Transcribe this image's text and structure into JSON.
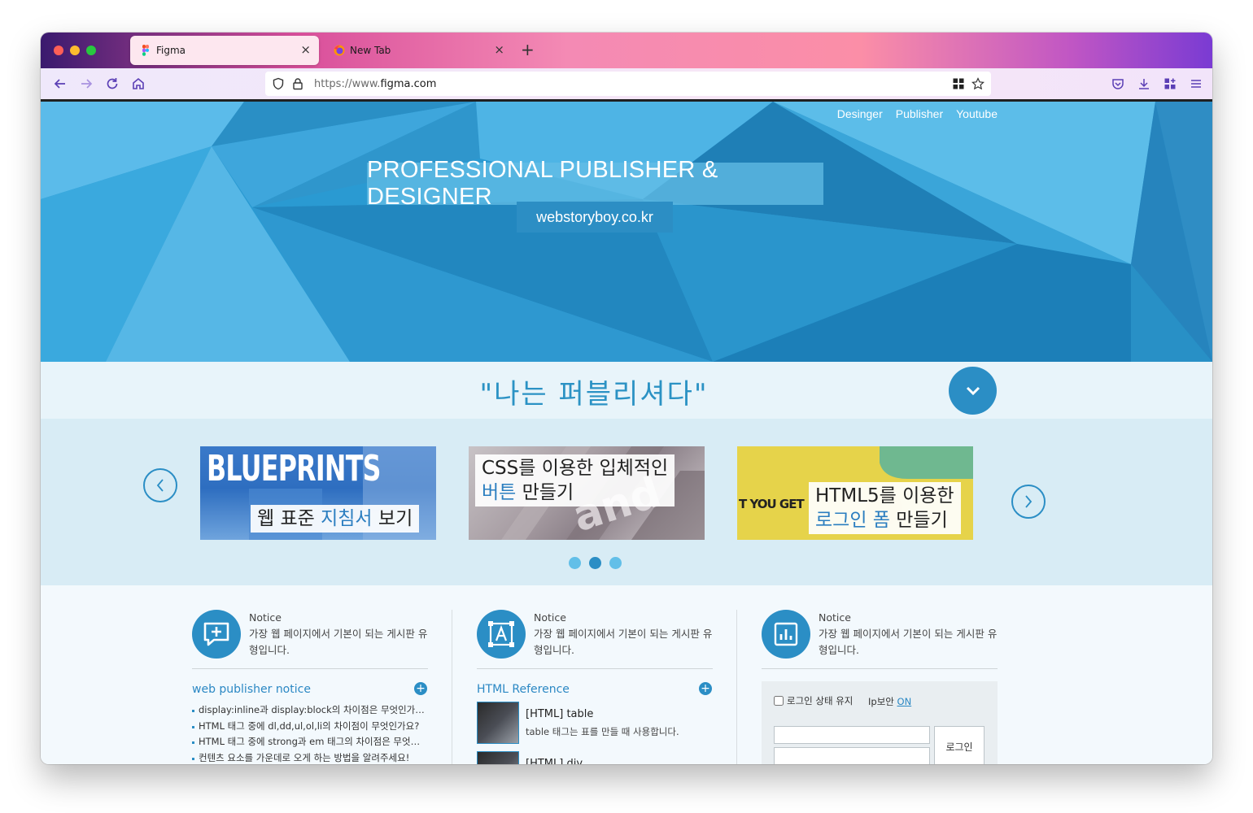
{
  "browser": {
    "tabs": [
      {
        "title": "Figma",
        "active": true,
        "icon": "figma-icon"
      },
      {
        "title": "New Tab",
        "active": false,
        "icon": "firefox-icon"
      }
    ],
    "url_prefix": "https://www.",
    "url_domain": "figma.com",
    "accent": "#5b3fb5"
  },
  "hero": {
    "nav": [
      "Desinger",
      "Publisher",
      "Youtube"
    ],
    "title": "PROFESSIONAL PUBLISHER & DESIGNER",
    "subtitle": "webstoryboy.co.kr"
  },
  "slogan": "\"나는 퍼블리셔다\"",
  "slider": {
    "cards": [
      {
        "image_text": "BLUEPRINTS",
        "caption_before": "웹 표준 ",
        "caption_highlight": "지침서",
        "caption_after": " 보기"
      },
      {
        "caption_line1": "CSS를 이용한 입체적인",
        "caption_highlight": "버튼",
        "caption_after": " 만들기"
      },
      {
        "image_text": "T YOU GET",
        "caption_line1": "HTML5를 이용한",
        "caption_highlight": "로그인 폼",
        "caption_after": " 만들기"
      }
    ],
    "dots": 3,
    "active_dot": 1
  },
  "columns": [
    {
      "head_title": "Notice",
      "head_desc": "가장 웹 페이지에서 기본이 되는 게시판 유형입니다.",
      "section_title": "web publisher notice",
      "items": [
        "display:inline과 display:block의 차이점은 무엇인가요?",
        "HTML 태그 중에 dl,dd,ul,ol,li의 차이점이 무엇인가요?",
        "HTML 태그 중에 strong과 em 태그의 차이점은 무엇인가요?",
        "컨텐츠 요소를 가운데로 오게 하는 방법을 알려주세요!"
      ]
    },
    {
      "head_title": "Notice",
      "head_desc": "가장 웹 페이지에서 기본이 되는 게시판 유형입니다.",
      "section_title": "HTML Reference",
      "refs": [
        {
          "title": "[HTML] table",
          "desc": "table 태그는 표를 만들 때 사용합니다."
        },
        {
          "title": "[HTML] div",
          "desc": ""
        }
      ]
    },
    {
      "head_title": "Notice",
      "head_desc": "가장 웹 페이지에서 기본이 되는 게시판 유형입니다.",
      "login": {
        "keep_label": "로그인 상태 유지",
        "ip_label": "Ip보안",
        "ip_state": "ON",
        "button_label": "로그인"
      }
    }
  ]
}
